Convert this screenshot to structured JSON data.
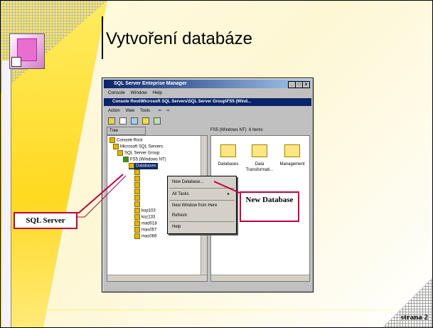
{
  "slide": {
    "title": "Vytvoření databáze",
    "page_label": "strana 2"
  },
  "app": {
    "window_title": "SQL Server Enteprise Manager",
    "menus": [
      "Console",
      "Window",
      "Help"
    ],
    "mdi_title": "Console Root\\Microsoft SQL Servers\\SQL Server Group\\FS5 (Wind...",
    "child_menus": [
      "Action",
      "View",
      "Tools"
    ],
    "tree_tab": "Tree",
    "right_header": "FS5 (Windows NT)",
    "right_count": "6 Items"
  },
  "tree": {
    "items": [
      "Console Root",
      "Microsoft SQL Servers",
      "SQL Server Group",
      "FS5 (Windows NT)",
      "Databases",
      "kop103",
      "koz133",
      "mad018",
      "mas057",
      "mas069"
    ]
  },
  "right_pane": {
    "folders": [
      "Databases",
      "Data Transformati...",
      "Management"
    ]
  },
  "context_menu": {
    "items": [
      "New Database...",
      "All Tasks",
      "New Window from Here",
      "Refresh",
      "Help"
    ]
  },
  "callouts": {
    "sql_server": "SQL Server",
    "new_database": "New Database"
  },
  "colors": {
    "accent_red": "#c0003c",
    "title_bar": "#0a246a",
    "background_yellow": "#ffd400"
  }
}
